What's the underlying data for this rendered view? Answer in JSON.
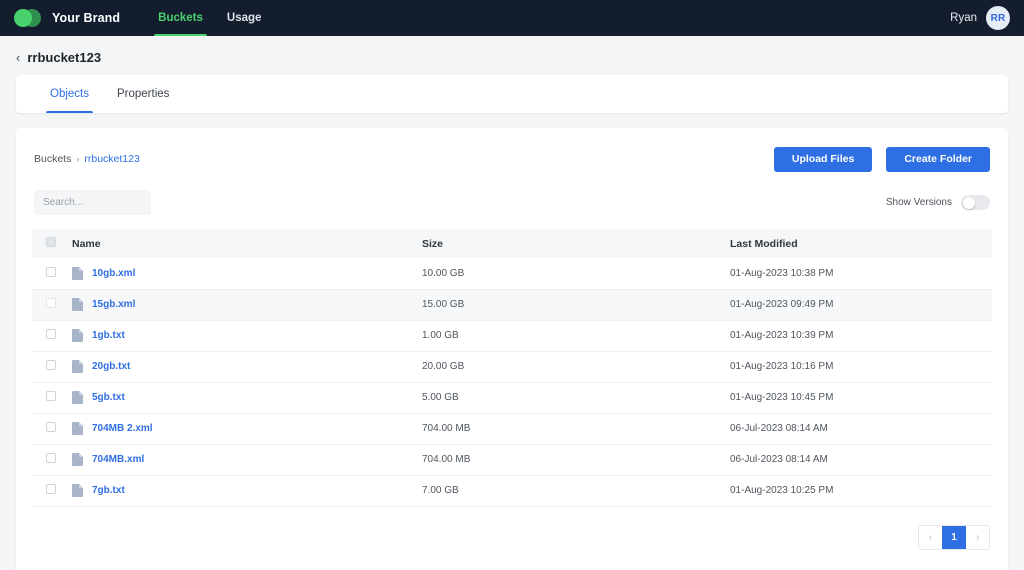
{
  "topbar": {
    "brand_name": "Your Brand",
    "nav": [
      {
        "label": "Buckets",
        "active": true
      },
      {
        "label": "Usage",
        "active": false
      }
    ],
    "user_name": "Ryan",
    "avatar_initials": "RR",
    "bg_color": "#141d2e",
    "accent_color": "#49d16d"
  },
  "page": {
    "back_chevron": "‹",
    "title": "rrbucket123"
  },
  "tabs": [
    {
      "label": "Objects",
      "active": true
    },
    {
      "label": "Properties",
      "active": false
    }
  ],
  "breadcrumb": {
    "root": "Buckets",
    "separator": "›",
    "current": "rrbucket123"
  },
  "toolbar": {
    "upload_label": "Upload Files",
    "create_folder_label": "Create Folder",
    "button_color": "#2f6fe4"
  },
  "filters": {
    "search_placeholder": "Search...",
    "search_value": "",
    "show_versions_label": "Show Versions",
    "show_versions_on": false
  },
  "table": {
    "columns": [
      "Name",
      "Size",
      "Last Modified"
    ],
    "rows": [
      {
        "name": "10gb.xml",
        "size": "10.00 GB",
        "modified": "01-Aug-2023 10:38 PM",
        "highlight": false
      },
      {
        "name": "15gb.xml",
        "size": "15.00 GB",
        "modified": "01-Aug-2023 09:49 PM",
        "highlight": true
      },
      {
        "name": "1gb.txt",
        "size": "1.00 GB",
        "modified": "01-Aug-2023 10:39 PM",
        "highlight": false
      },
      {
        "name": "20gb.txt",
        "size": "20.00 GB",
        "modified": "01-Aug-2023 10:16 PM",
        "highlight": false
      },
      {
        "name": "5gb.txt",
        "size": "5.00 GB",
        "modified": "01-Aug-2023 10:45 PM",
        "highlight": false
      },
      {
        "name": "704MB 2.xml",
        "size": "704.00 MB",
        "modified": "06-Jul-2023 08:14 AM",
        "highlight": false
      },
      {
        "name": "704MB.xml",
        "size": "704.00 MB",
        "modified": "06-Jul-2023 08:14 AM",
        "highlight": false
      },
      {
        "name": "7gb.txt",
        "size": "7.00 GB",
        "modified": "01-Aug-2023 10:25 PM",
        "highlight": false
      }
    ]
  },
  "pagination": {
    "prev": "‹",
    "next": "›",
    "pages": [
      "1"
    ],
    "current_page": "1"
  }
}
